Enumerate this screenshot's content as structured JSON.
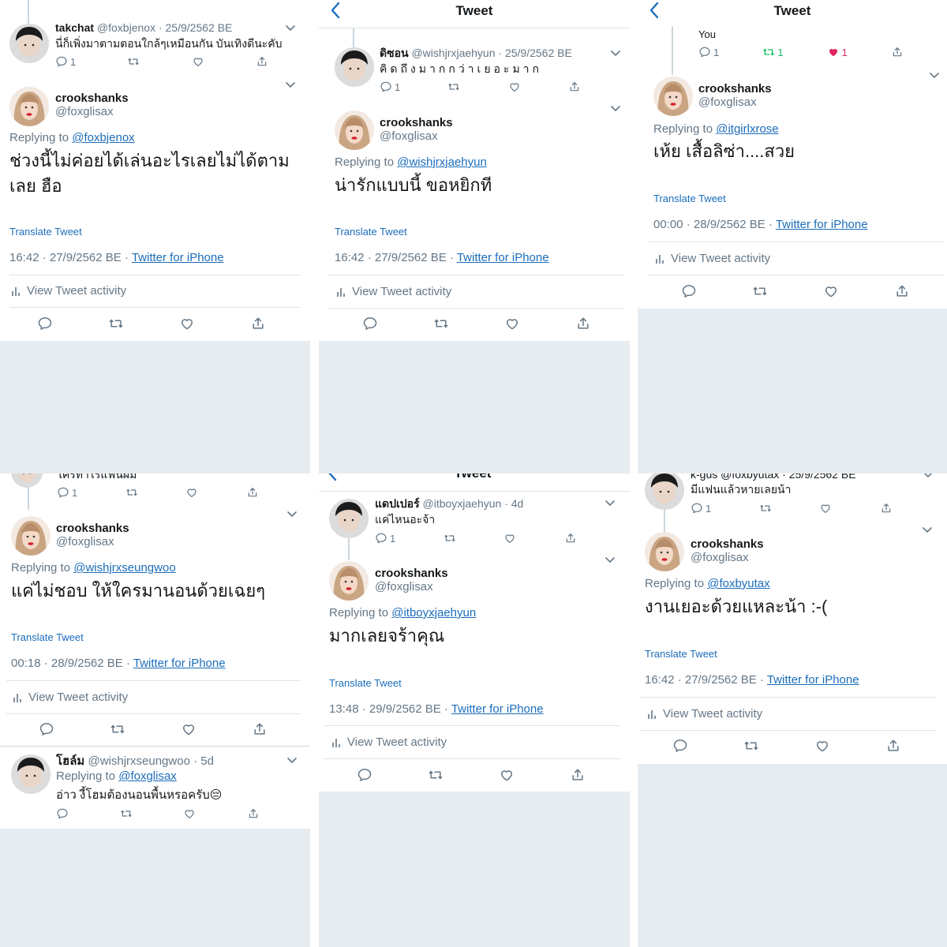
{
  "common": {
    "main_name": "crookshanks",
    "main_handle": "@foxglisax",
    "replying_to": "Replying to",
    "translate": "Translate Tweet",
    "activity": "View Tweet activity",
    "header_title": "Tweet",
    "client": "Twitter for iPhone"
  },
  "panels": [
    {
      "parent_name": "takchat",
      "parent_handle": "@foxbjenox",
      "parent_date": "· 25/9/2562 BE",
      "parent_text": "นี่ก็เพิ่งมาตามตอนใกล้ๆเหมือนกัน บันเทิงดีนะคับ",
      "parent_reply_count": "1",
      "reply_to": "@foxbjenox",
      "body": "ช่วงนี้ไม่ค่อยได้เล่นอะไรเลยไม่ได้ตามเลย ฮือ",
      "time": "16:42 · 27/9/2562 BE ·"
    },
    {
      "parent_name": "ดิซอน",
      "parent_handle": "@wishjrxjaehyun",
      "parent_date": "· 25/9/2562 BE",
      "parent_text": "คิดถึงมากกว่าเยอะมาก",
      "parent_reply_count": "1",
      "reply_to": "@wishjrxjaehyun",
      "body": "น่ารักแบบนี้ ขอหยิกที",
      "time": "16:42 · 27/9/2562 BE ·"
    },
    {
      "parent_label": "You",
      "parent_reply_count": "1",
      "parent_rt_count": "1",
      "parent_like_count": "1",
      "reply_to": "@itgirlxrose",
      "body": "เห้ย เสื้อลิซ่า....สวย",
      "time": "00:00 · 28/9/2562 BE ·"
    },
    {
      "parent_partial": "ใครทำไรแฟนผม",
      "parent_reply_count": "1",
      "reply_to": "@wishjrxseungwoo",
      "body": "แค่ไม่ชอบ ให้ใครมานอนด้วยเฉยๆ",
      "time": "00:18 · 28/9/2562 BE ·",
      "child_name": "โฮล์ม",
      "child_handle": "@wishjrxseungwoo · 5d",
      "child_reply_label": "Replying to",
      "child_reply_to": "@foxglisax",
      "child_text": "อ่าว งี้โฮมต้องนอนพื้นหรอครับ😔"
    },
    {
      "parent_name": "แดปเปอร์",
      "parent_handle": "@itboyxjaehyun · 4d",
      "parent_text": "แค่ไหนอะจ้า",
      "parent_reply_count": "1",
      "reply_to": "@itboyxjaehyun",
      "body": "มากเลยจร้าคุณ",
      "time": "13:48 · 29/9/2562 BE ·"
    },
    {
      "parent_partial": "k-gus @foxbyutax · 25/9/2562 BE",
      "parent_text": "มีแฟนแล้วหายเลยน้า",
      "parent_reply_count": "1",
      "reply_to": "@foxbyutax",
      "body": "งานเยอะด้วยแหละน้า :-(",
      "time": "16:42 · 27/9/2562 BE ·"
    }
  ],
  "colors": {
    "link": "#1b6dbb",
    "gray": "#657786",
    "bg_gray": "#e6ecf0",
    "like_red": "#e0245e",
    "retweet_green": "#17bf63"
  }
}
